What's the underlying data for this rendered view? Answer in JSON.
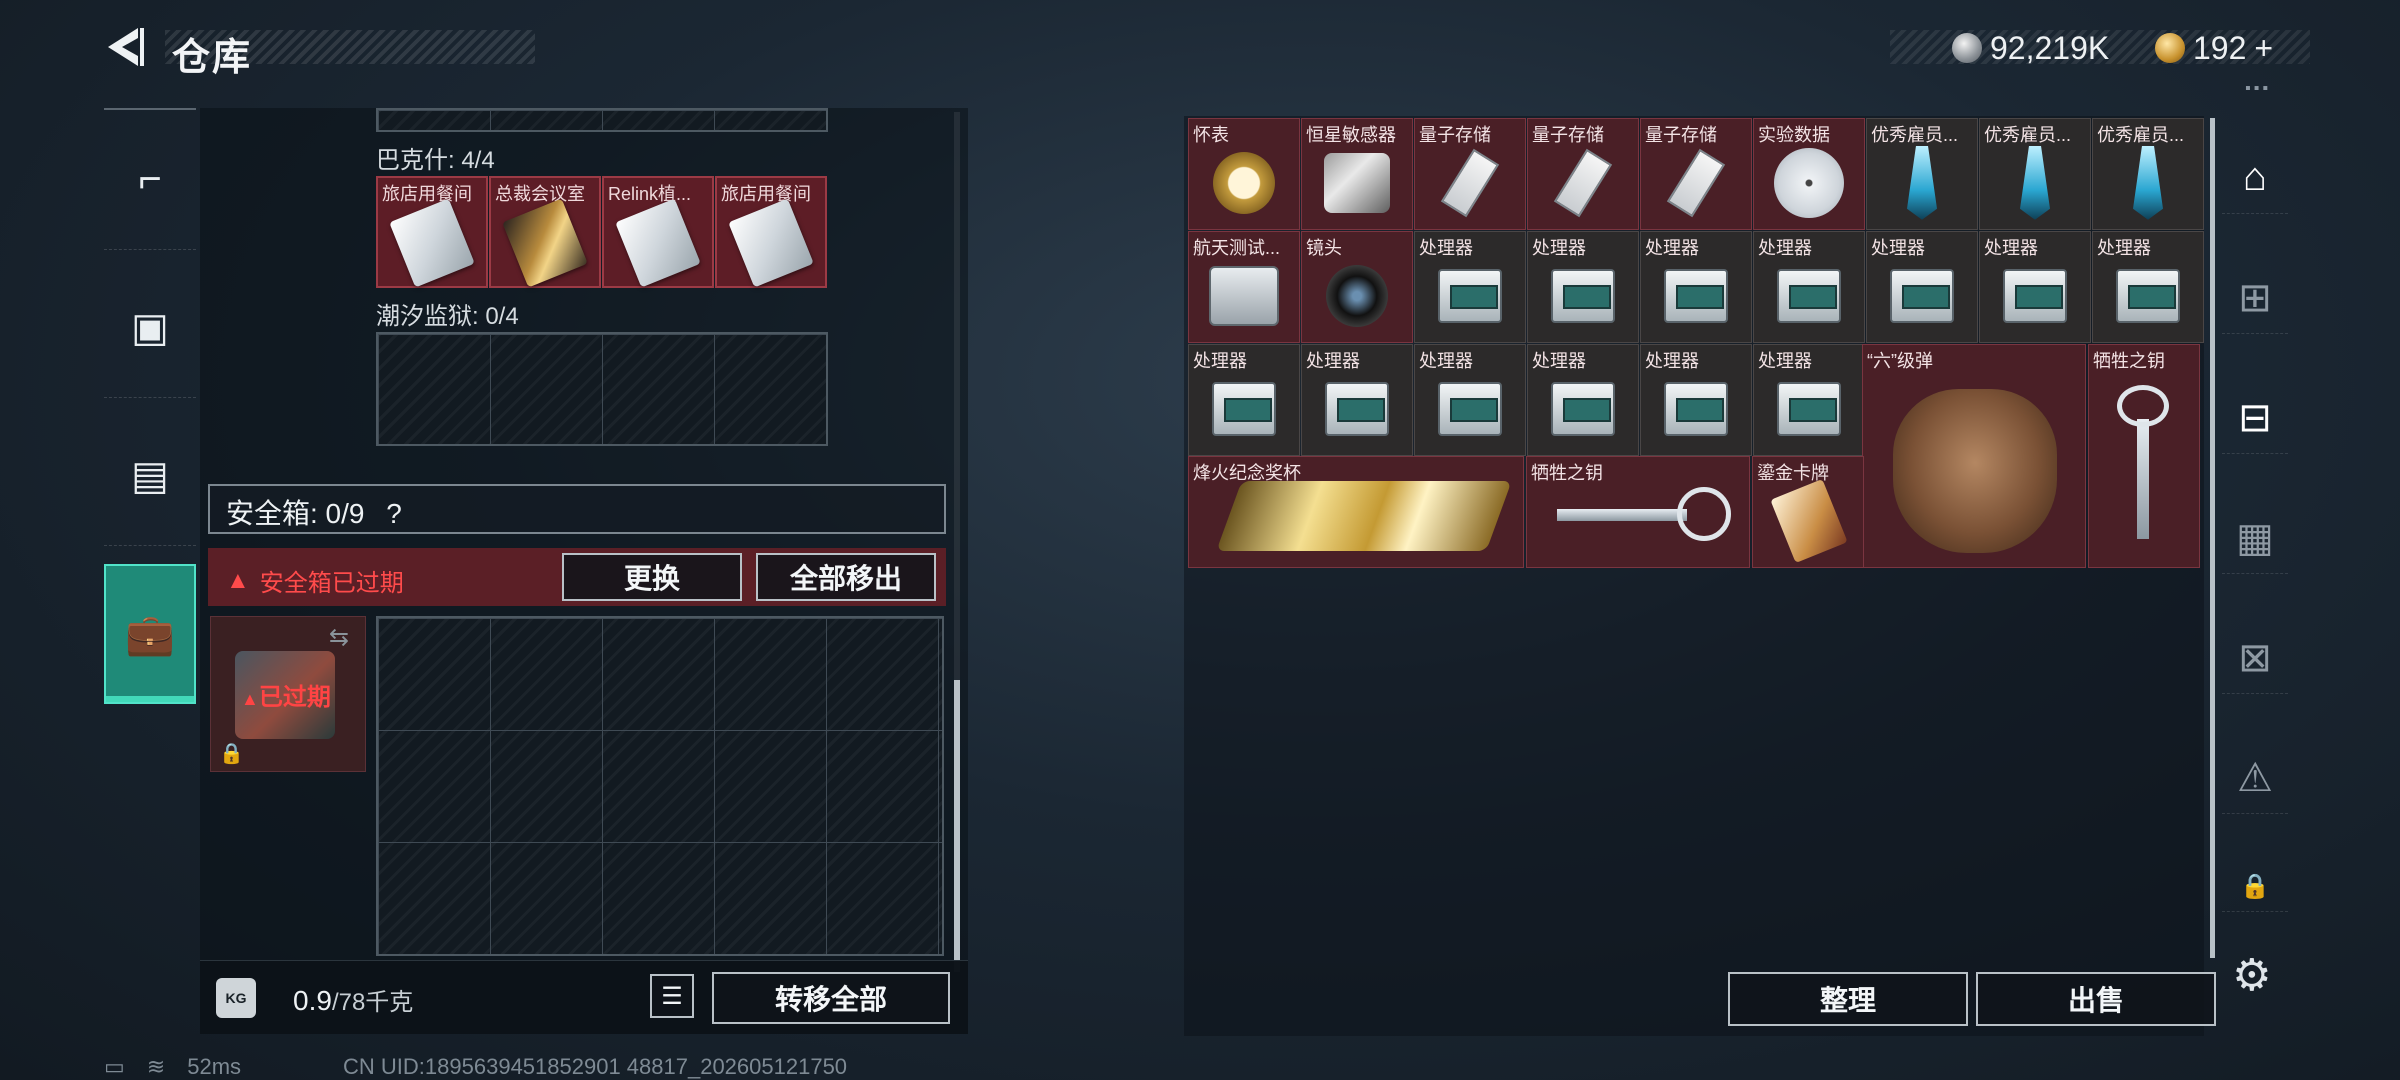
{
  "header": {
    "title": "仓库",
    "currency_silver": "92,219K",
    "currency_gold": "192",
    "gold_plus": "+"
  },
  "left_nav": {
    "items": [
      "gun-icon",
      "backpack-icon",
      "vest-icon",
      "briefcase-icon"
    ],
    "active_index": 3
  },
  "key_rooms": {
    "bakeshi_label": "巴克什: 4/4",
    "bakeshi_slots": [
      "旅店用餐间",
      "总裁会议室",
      "Relink植...",
      "旅店用餐间"
    ],
    "chaoxi_label": "潮汐监狱: 0/4"
  },
  "safe_box": {
    "title": "安全箱: 0/9",
    "help": "?",
    "expired_warning": "安全箱已过期",
    "replace_button": "更换",
    "move_all_out_button": "全部移出",
    "case_status": "已过期"
  },
  "weight": {
    "current": "0.9",
    "max_unit": "/78千克"
  },
  "transfer_all_button": "转移全部",
  "stash": {
    "items": [
      {
        "label": "怀表",
        "art": "watch"
      },
      {
        "label": "恒星敏感器",
        "art": "sensor"
      },
      {
        "label": "量子存储",
        "art": "usb"
      },
      {
        "label": "量子存储",
        "art": "usb"
      },
      {
        "label": "量子存储",
        "art": "usb"
      },
      {
        "label": "实验数据",
        "art": "disc"
      },
      {
        "label": "优秀雇员...",
        "art": "crystal"
      },
      {
        "label": "优秀雇员...",
        "art": "crystal"
      },
      {
        "label": "优秀雇员...",
        "art": "crystal"
      },
      {
        "label": "航天测试...",
        "art": "drive"
      },
      {
        "label": "镜头",
        "art": "lens"
      },
      {
        "label": "处理器",
        "art": "proc"
      },
      {
        "label": "处理器",
        "art": "proc"
      },
      {
        "label": "处理器",
        "art": "proc"
      },
      {
        "label": "处理器",
        "art": "proc"
      },
      {
        "label": "处理器",
        "art": "proc"
      },
      {
        "label": "处理器",
        "art": "proc"
      },
      {
        "label": "处理器",
        "art": "proc"
      },
      {
        "label": "处理器",
        "art": "proc"
      },
      {
        "label": "处理器",
        "art": "proc"
      },
      {
        "label": "处理器",
        "art": "proc"
      },
      {
        "label": "处理器",
        "art": "proc"
      },
      {
        "label": "处理器",
        "art": "proc"
      },
      {
        "label": "处理器",
        "art": "proc"
      }
    ],
    "big_items": {
      "hand": "“六”级弹",
      "key_tall": "牺牲之钥",
      "trophy": "烽火纪念奖杯",
      "key_wide": "牺牲之钥",
      "card": "鎏金卡牌"
    },
    "sort_button": "整理",
    "sell_button": "出售"
  },
  "status_bar": {
    "ping": "52ms",
    "uid": "CN UID:1895639451852901 48817_202605121750"
  }
}
